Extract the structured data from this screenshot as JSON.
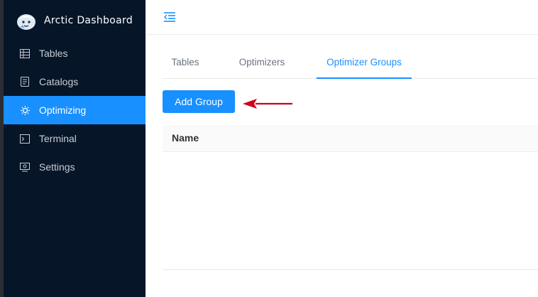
{
  "app": {
    "title": "Arctic Dashboard",
    "logo_icon": "arctic-bear-logo-icon"
  },
  "sidebar": {
    "items": [
      {
        "label": "Tables",
        "icon": "table-icon",
        "active": false
      },
      {
        "label": "Catalogs",
        "icon": "catalog-icon",
        "active": false
      },
      {
        "label": "Optimizing",
        "icon": "optimizing-gear-icon",
        "active": true
      },
      {
        "label": "Terminal",
        "icon": "terminal-icon",
        "active": false
      },
      {
        "label": "Settings",
        "icon": "settings-monitor-icon",
        "active": false
      }
    ]
  },
  "header": {
    "collapse_icon": "menu-fold-icon"
  },
  "tabs": [
    {
      "label": "Tables",
      "active": false
    },
    {
      "label": "Optimizers",
      "active": false
    },
    {
      "label": "Optimizer Groups",
      "active": true
    }
  ],
  "toolbar": {
    "add_group_label": "Add Group"
  },
  "table": {
    "columns": [
      "Name"
    ],
    "rows": []
  },
  "colors": {
    "sidebar_bg": "#061528",
    "accent": "#1890ff",
    "annotation_arrow": "#d0021b"
  }
}
